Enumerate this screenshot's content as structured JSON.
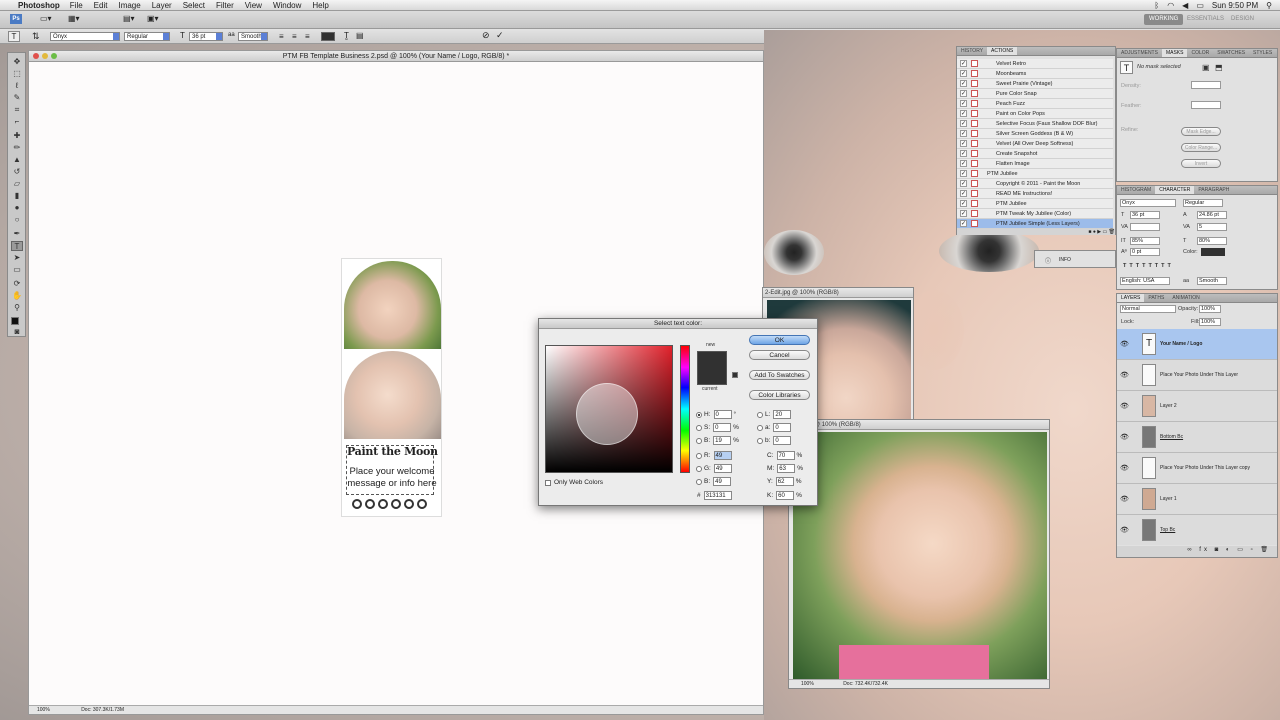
{
  "menubar": {
    "app_name": "Photoshop",
    "menus": [
      "File",
      "Edit",
      "Image",
      "Layer",
      "Select",
      "Filter",
      "View",
      "Window",
      "Help"
    ],
    "clock": "Sun 9:50 PM"
  },
  "appbar": {
    "workspaces": [
      "WORKING",
      "ESSENTIALS",
      "DESIGN"
    ]
  },
  "options": {
    "font": "Onyx",
    "style": "Regular",
    "size": "36 pt",
    "aa": "Smooth"
  },
  "document": {
    "title": "PTM FB Template Business 2.psd @ 100% (Your Name / Logo, RGB/8) *",
    "zoom": "100%",
    "doc_size": "Doc: 307.3K/1.73M"
  },
  "template": {
    "title": "Paint the Moon",
    "message": "Place your welcome message or info here"
  },
  "photo_windows": {
    "win1_title": "2-Edit.jpg @ 100% (RGB/8)",
    "win2_title": "dit-2.jpg @ 100% (RGB/8)",
    "win2_zoom": "100%",
    "win2_doc": "Doc: 732.4K/732.4K"
  },
  "color_dialog": {
    "title": "Select text color:",
    "ok": "OK",
    "cancel": "Cancel",
    "add_swatches": "Add To Swatches",
    "libraries": "Color Libraries",
    "new_label": "new",
    "current_label": "current",
    "only_web": "Only Web Colors",
    "H": "0",
    "S": "0",
    "Bv": "19",
    "R": "49",
    "G": "49",
    "Bl": "49",
    "L": "20",
    "a": "0",
    "b": "0",
    "C": "70",
    "M": "63",
    "Y": "62",
    "K": "60",
    "hex": "313131",
    "deg": "°",
    "pct": "%"
  },
  "actions_panel": {
    "tabs": [
      "HISTORY",
      "ACTIONS"
    ],
    "items": [
      "Velvet Retro",
      "Moonbeams",
      "Sweet Prairie (Vintage)",
      "Pure Color Snap",
      "Peach Fuzz",
      "Paint on Color Pops",
      "Selective Focus (Faux Shallow DOF Blur)",
      "Silver Screen Goddess (B & W)",
      "Velvet (All Over Deep Softness)",
      "Create Snapshot",
      "Flatten Image",
      "PTM Jubilee",
      "Copyright © 2011 - Paint the Moon",
      "READ ME Instructions!",
      "PTM Jubilee",
      "PTM Tweak My Jubilee (Color)",
      "PTM Jubilee Simple (Less Layers)"
    ]
  },
  "info_panel": {
    "label": "INFO"
  },
  "masks_panel": {
    "tabs": [
      "ADJUSTMENTS",
      "MASKS",
      "COLOR",
      "SWATCHES",
      "STYLES"
    ],
    "status": "No mask selected",
    "density": "Density:",
    "feather": "Feather:",
    "refine": "Refine:",
    "mask_edge": "Mask Edge...",
    "color_range": "Color Range...",
    "invert": "Invert"
  },
  "character_panel": {
    "tabs": [
      "HISTOGRAM",
      "CHARACTER",
      "PARAGRAPH"
    ],
    "font": "Onyx",
    "style": "Regular",
    "size": "36 pt",
    "leading": "24.86 pt",
    "tracking": "5",
    "vscale": "85%",
    "hscale": "80%",
    "baseline": "0 pt",
    "color_label": "Color:",
    "language": "English: USA",
    "aa": "Smooth"
  },
  "layers_panel": {
    "tabs": [
      "LAYERS",
      "PATHS",
      "ANIMATION"
    ],
    "blend": "Normal",
    "opacity_label": "Opacity:",
    "opacity": "100%",
    "fill_label": "Fill:",
    "fill": "100%",
    "lock_label": "Lock:",
    "layers": [
      "Your Name / Logo",
      "Place Your Photo Under This Layer",
      "Layer 2",
      "Bottom Bc",
      "Place Your Photo Under This Layer copy",
      "Layer 1",
      "Top Bc"
    ]
  }
}
